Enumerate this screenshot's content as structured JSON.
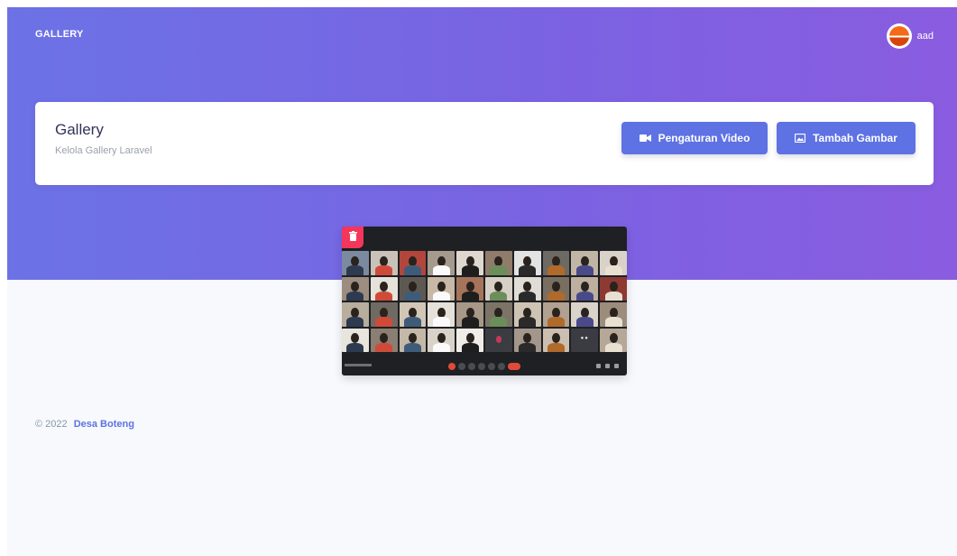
{
  "navbar": {
    "brand": "GALLERY",
    "user_name": "aad"
  },
  "header": {
    "title": "Gallery",
    "subtitle": "Kelola Gallery Laravel",
    "buttons": {
      "video_settings": {
        "label": "Pengaturan Video",
        "icon": "video-camera-icon"
      },
      "add_image": {
        "label": "Tambah Gambar",
        "icon": "image-icon"
      }
    }
  },
  "gallery": {
    "items": [
      {
        "type": "image",
        "description_icon": "video-call-screenshot",
        "delete_icon": "trash-icon"
      }
    ]
  },
  "footer": {
    "copyright": "© 2022",
    "link_label": "Desa Boteng"
  },
  "colors": {
    "primary": "#5e72e4",
    "danger": "#f5365c",
    "hero_gradient_start": "#6c72e6",
    "hero_gradient_end": "#8a5ce0"
  }
}
